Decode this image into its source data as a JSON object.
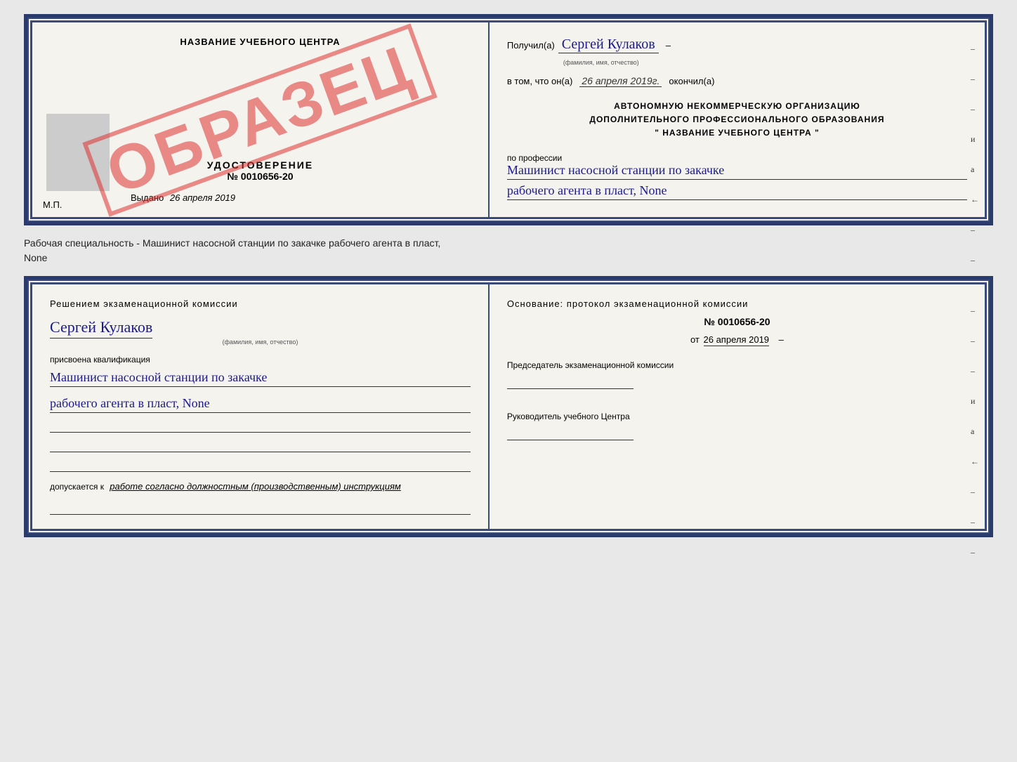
{
  "top_document": {
    "left": {
      "training_center": "НАЗВАНИЕ УЧЕБНОГО ЦЕНТРА",
      "certificate_label": "УДОСТОВЕРЕНИЕ",
      "certificate_number": "№ 0010656-20",
      "issued_label": "Выдано",
      "issued_date": "26 апреля 2019",
      "mp_label": "М.П."
    },
    "stamp": "ОБРАЗЕЦ",
    "right": {
      "received_label": "Получил(а)",
      "recipient_name": "Сергей Кулаков",
      "fio_sublabel": "(фамилия, имя, отчество)",
      "dash1": "–",
      "date_prefix": "в том, что он(а)",
      "date_value": "26 апреля 2019г.",
      "date_suffix": "окончил(а)",
      "org_line1": "АВТОНОМНУЮ НЕКОММЕРЧЕСКУЮ ОРГАНИЗАЦИЮ",
      "org_line2": "ДОПОЛНИТЕЛЬНОГО ПРОФЕССИОНАЛЬНОГО ОБРАЗОВАНИЯ",
      "org_line3": "\"  НАЗВАНИЕ УЧЕБНОГО ЦЕНТРА  \"",
      "dash_i": "и",
      "dash_a": "а",
      "dash_arrow": "←",
      "profession_label": "по профессии",
      "profession_line1": "Машинист насосной станции по закачке",
      "profession_line2": "рабочего агента в пласт, None"
    }
  },
  "separator": {
    "text_line1": "Рабочая специальность - Машинист насосной станции по закачке рабочего агента в пласт,",
    "text_line2": "None"
  },
  "bottom_document": {
    "left": {
      "commission_text": "Решением экзаменационной комиссии",
      "person_name": "Сергей Кулаков",
      "fio_sublabel": "(фамилия, имя, отчество)",
      "qualification_label": "присвоена квалификация",
      "qualification_line1": "Машинист насосной станции по закачке",
      "qualification_line2": "рабочего агента в пласт, None",
      "allowed_prefix": "допускается к",
      "allowed_text": "работе согласно должностным (производственным) инструкциям"
    },
    "right": {
      "basis_text": "Основание: протокол экзаменационной комиссии",
      "protocol_number": "№ 0010656-20",
      "protocol_date_prefix": "от",
      "protocol_date": "26 апреля 2019",
      "chairman_label": "Председатель экзаменационной комиссии",
      "director_label": "Руководитель учебного Центра",
      "dash_i": "и",
      "dash_a": "а",
      "dash_arrow": "←"
    }
  }
}
